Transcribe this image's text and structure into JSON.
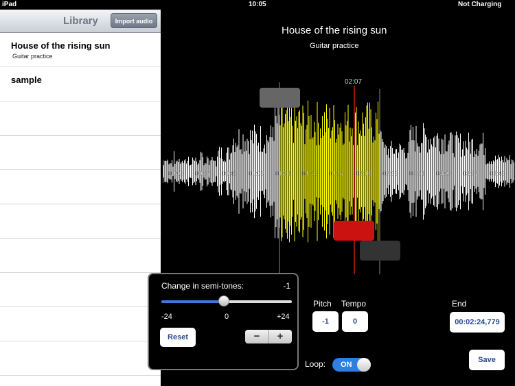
{
  "status": {
    "device": "iPad",
    "time": "10:05",
    "battery": "Not Charging"
  },
  "library": {
    "title": "Library",
    "import_label": "Import audio",
    "items": [
      {
        "title": "House of the rising sun",
        "subtitle": "Guitar practice"
      },
      {
        "title": "sample",
        "subtitle": ""
      }
    ]
  },
  "player": {
    "song_title": "House of the rising sun",
    "song_subtitle": "Guitar practice",
    "playhead_time": "02:07",
    "timeline_labels": [
      "00:09",
      "00:27",
      "00:45",
      "01:03",
      "01:21",
      "01:39",
      "01:57",
      "02:15",
      "02:33",
      "02:51",
      "03:09",
      "03:27",
      "03:45"
    ],
    "colors": {
      "waveform": "#ffffff",
      "selection": "#ffff00",
      "playhead": "#ff2020",
      "marker": "#666666"
    }
  },
  "pitch_popover": {
    "label": "Change in semi-tones:",
    "value": "-1",
    "min": "-24",
    "mid": "0",
    "max": "+24",
    "level_fraction": 0.479,
    "reset_label": "Reset",
    "minus": "−",
    "plus": "+"
  },
  "controls": {
    "pitch_label": "Pitch",
    "pitch_value": "-1",
    "tempo_label": "Tempo",
    "tempo_value": "0",
    "end_label": "End",
    "end_value": "00:02:24,779",
    "loop_label": "Loop:",
    "loop_state": "ON",
    "save_label": "Save"
  }
}
